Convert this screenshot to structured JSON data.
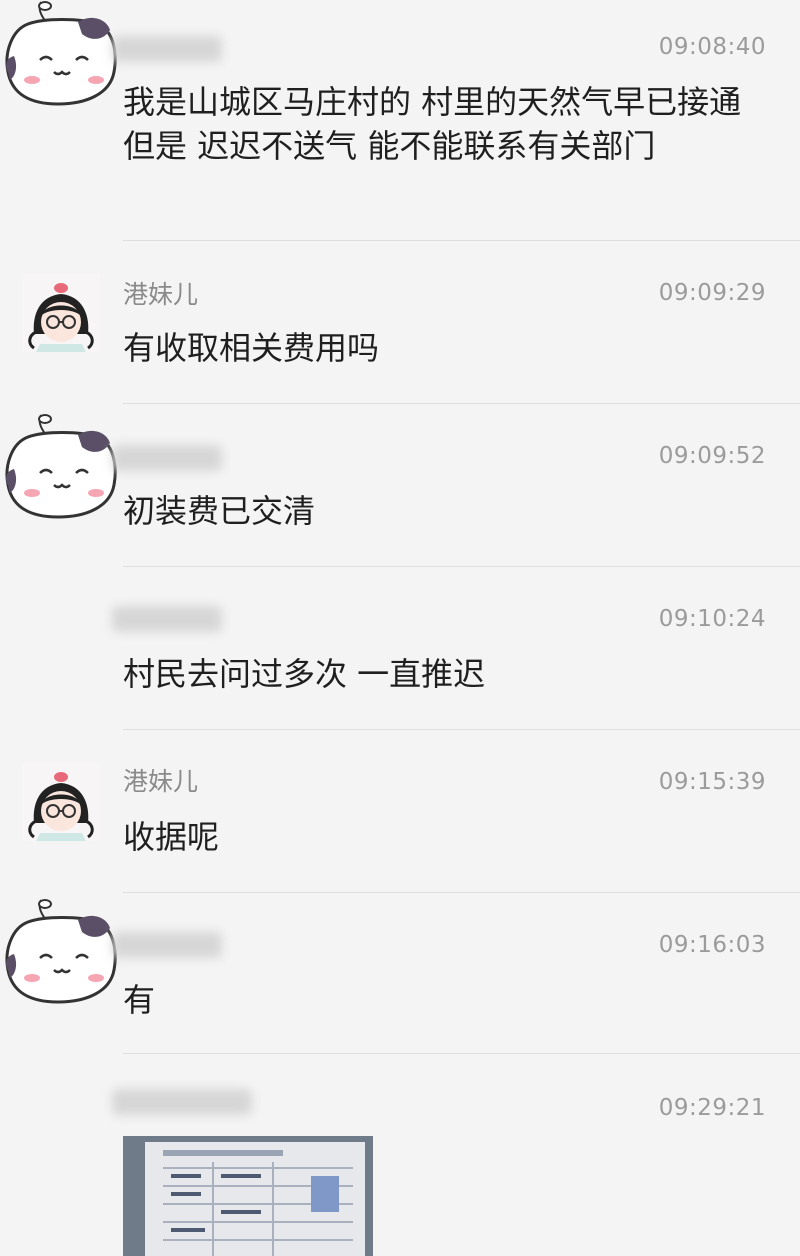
{
  "messages": [
    {
      "sender": "",
      "avatar": "cat-avatar",
      "time": "09:08:40",
      "text": "我是山城区马庄村的  村里的天然气早已接通  但是  迟迟不送气  能不能联系有关部门"
    },
    {
      "sender": "港妹儿",
      "avatar": "girl-avatar",
      "time": "09:09:29",
      "text": "有收取相关费用吗"
    },
    {
      "sender": "",
      "avatar": "cat-avatar",
      "time": "09:09:52",
      "text": "初装费已交清"
    },
    {
      "sender": "",
      "avatar": "none",
      "time": "09:10:24",
      "text": "村民去问过多次  一直推迟"
    },
    {
      "sender": "港妹儿",
      "avatar": "girl-avatar",
      "time": "09:15:39",
      "text": "收据呢"
    },
    {
      "sender": "",
      "avatar": "cat-avatar",
      "time": "09:16:03",
      "text": "有"
    },
    {
      "sender": "",
      "avatar": "none",
      "time": "09:29:21",
      "text": ""
    }
  ],
  "attachment": {
    "type": "receipt-photo-icon"
  },
  "colors": {
    "background": "#f4f4f4",
    "text": "#1f1f1f",
    "meta": "#9b9b9b",
    "divider": "#dedede"
  }
}
